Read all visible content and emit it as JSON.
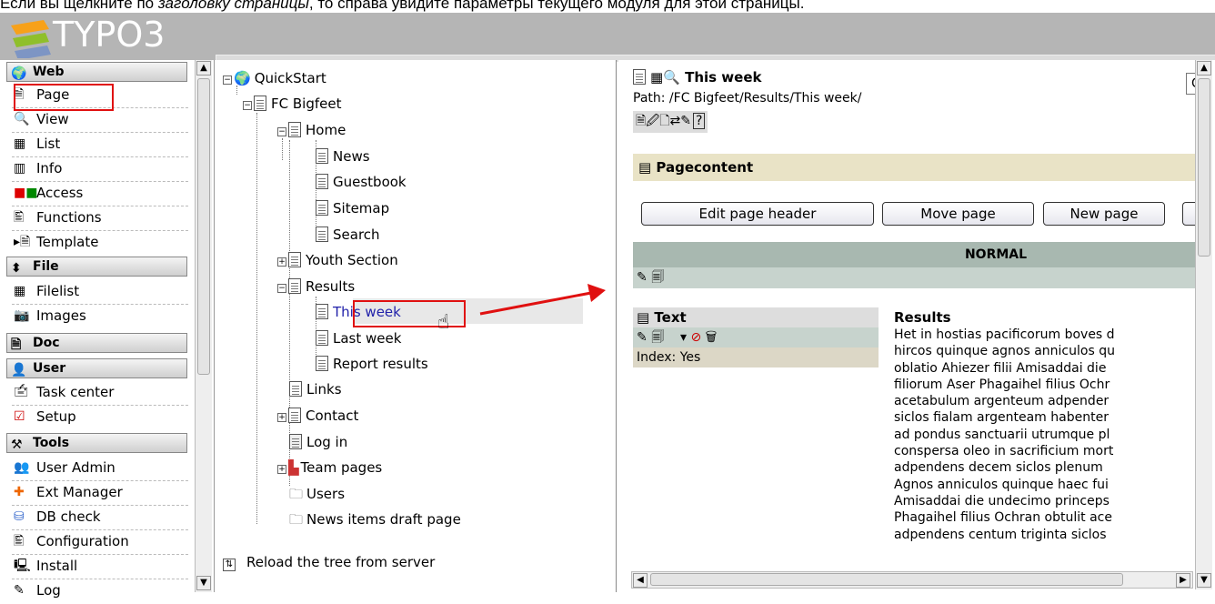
{
  "caption": {
    "before": "Если вы щелкните по ",
    "italic": "заголовку страницы",
    "after": ", то справа увидите параметры текущего модуля для этой страницы."
  },
  "logo_text": "TYPO3",
  "colors": {
    "highlight": "#e01010",
    "header": "#b5b5b5",
    "pagecontent_bg": "#e9e3c6",
    "normal_bar": "#a8b8b0"
  },
  "menu": {
    "web": {
      "title": "Web",
      "items": [
        {
          "label": "Page",
          "icon": "page-icon"
        },
        {
          "label": "View",
          "icon": "magnifier-icon"
        },
        {
          "label": "List",
          "icon": "list-icon"
        },
        {
          "label": "Info",
          "icon": "info-icon"
        },
        {
          "label": "Access",
          "icon": "access-icon"
        },
        {
          "label": "Functions",
          "icon": "functions-icon"
        },
        {
          "label": "Template",
          "icon": "template-icon"
        }
      ]
    },
    "file": {
      "title": "File",
      "items": [
        {
          "label": "Filelist",
          "icon": "filelist-icon"
        },
        {
          "label": "Images",
          "icon": "camera-icon"
        }
      ]
    },
    "doc": {
      "title": "Doc"
    },
    "user": {
      "title": "User",
      "items": [
        {
          "label": "Task center",
          "icon": "task-center-icon"
        },
        {
          "label": "Setup",
          "icon": "checkbox-icon"
        }
      ]
    },
    "tools": {
      "title": "Tools",
      "items": [
        {
          "label": "User Admin",
          "icon": "users-icon"
        },
        {
          "label": "Ext Manager",
          "icon": "puzzle-icon"
        },
        {
          "label": "DB check",
          "icon": "database-icon"
        },
        {
          "label": "Configuration",
          "icon": "configuration-icon"
        },
        {
          "label": "Install",
          "icon": "computer-icon"
        },
        {
          "label": "Log",
          "icon": "log-icon"
        }
      ]
    }
  },
  "tree": {
    "root": "QuickStart",
    "nodes": [
      "FC Bigfeet",
      "Home",
      "News",
      "Guestbook",
      "Sitemap",
      "Search",
      "Youth Section",
      "Results",
      "This week",
      "Last week",
      "Report results",
      "Links",
      "Contact",
      "Log in",
      "Team pages",
      "Users",
      "News items draft page"
    ],
    "reload": "Reload the tree from server"
  },
  "content": {
    "title": "This week",
    "path": "Path: /FC Bigfeet/Results/This week/",
    "section": "Pagecontent",
    "buttons": [
      "Edit page header",
      "Move page",
      "New page"
    ],
    "column": "NORMAL",
    "element": {
      "type": "Text",
      "index": "Index: Yes"
    },
    "results_heading": "Results",
    "results_lines": [
      "Het in hostias pacificorum boves d",
      "hircos quinque agnos anniculos qu",
      "oblatio Ahiezer filii Amisaddai die",
      "filiorum Aser Phagaihel filius Ochr",
      "acetabulum argenteum adpender",
      "siclos fialam argenteam habenter",
      "ad pondus sanctuarii utrumque pl",
      "conspersa oleo in sacrificium mort",
      "adpendens decem siclos plenum",
      "Agnos anniculos quinque haec fui",
      "Amisaddai die undecimo princeps",
      "Phagaihel filius Ochran obtulit ace",
      "adpendens centum triginta siclos"
    ],
    "top_right_letter": "C"
  }
}
